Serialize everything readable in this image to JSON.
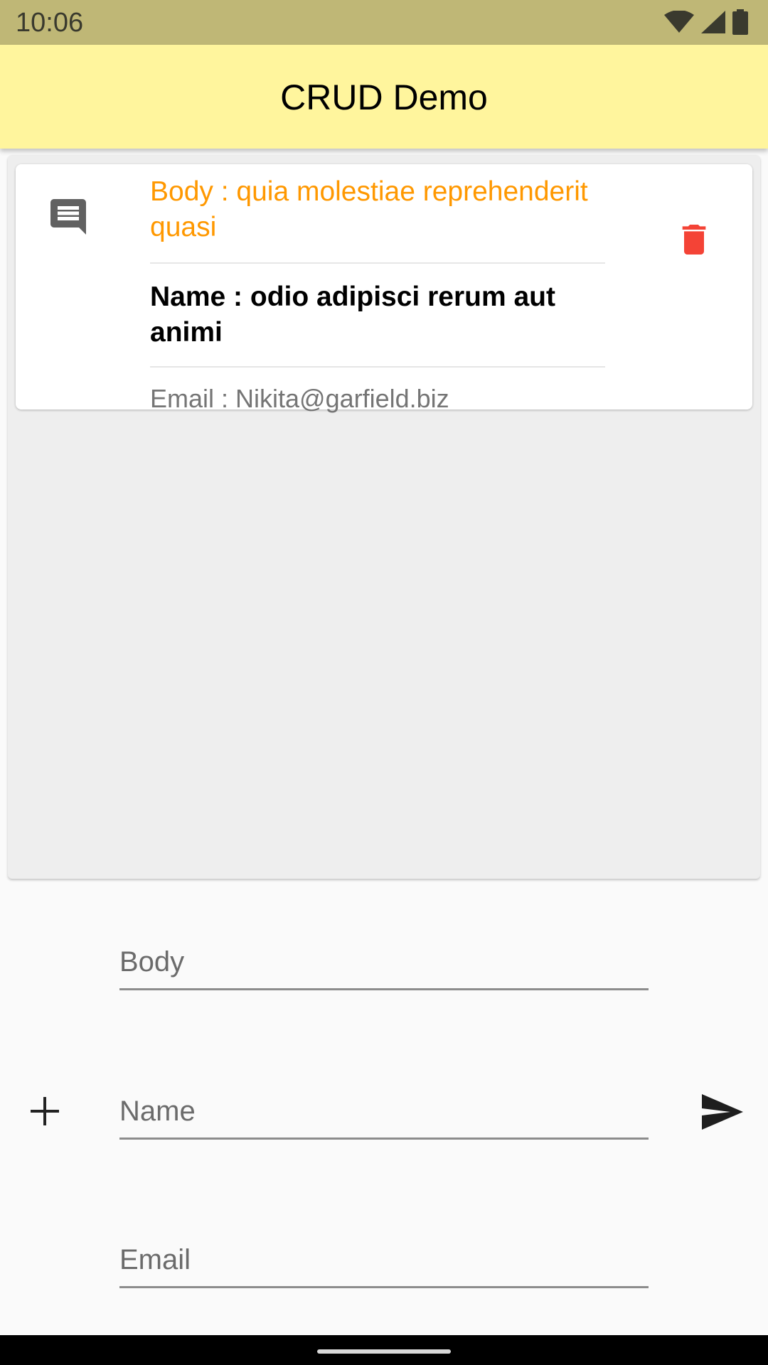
{
  "status_bar": {
    "time": "10:06",
    "icons": [
      "wifi-icon",
      "cell-signal-icon",
      "battery-icon"
    ]
  },
  "app_bar": {
    "title": "CRUD Demo",
    "background": "#fff59d"
  },
  "comments": [
    {
      "icon": "comment-icon",
      "body": "Body : quia molestiae reprehenderit quasi",
      "name": "Name : odio adipisci rerum aut animi",
      "email": "Email :  Nikita@garfield.biz",
      "body_color": "#ff9800",
      "delete_icon": "trash-icon",
      "delete_color": "#f44336"
    }
  ],
  "form": {
    "body_placeholder": "Body",
    "name_placeholder": "Name",
    "email_placeholder": "Email",
    "add_icon": "plus-icon",
    "send_icon": "send-icon"
  }
}
